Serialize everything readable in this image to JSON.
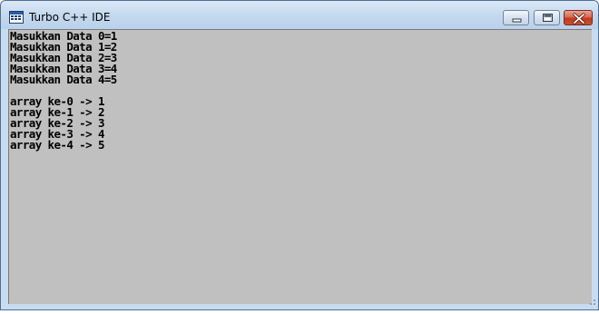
{
  "window": {
    "title": "Turbo C++ IDE",
    "icon": "console-app-icon"
  },
  "controls": {
    "minimize_icon": "minimize-icon",
    "maximize_icon": "maximize-icon",
    "close_icon": "close-icon"
  },
  "console": {
    "input_lines": [
      "Masukkan Data 0=1",
      "Masukkan Data 1=2",
      "Masukkan Data 2=3",
      "Masukkan Data 3=4",
      "Masukkan Data 4=5"
    ],
    "output_lines": [
      "array ke-0 -> 1",
      "array ke-1 -> 2",
      "array ke-2 -> 3",
      "array ke-3 -> 4",
      "array ke-4 -> 5"
    ],
    "background": "#c0c0c0",
    "text_color": "#000000"
  }
}
